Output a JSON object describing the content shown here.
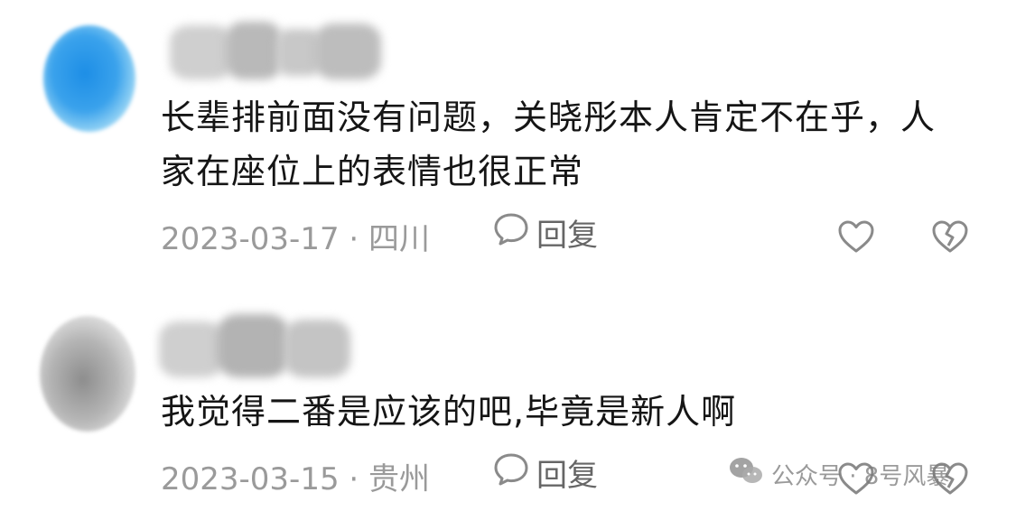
{
  "comments": [
    {
      "text": "长辈排前面没有问题，关晓彤本人肯定不在乎，人家在座位上的表情也很正常",
      "date": "2023-03-17",
      "location": "四川",
      "reply_label": "回复"
    },
    {
      "text": "我觉得二番是应该的吧,毕竟是新人啊",
      "date": "2023-03-15",
      "location": "贵州",
      "reply_label": "回复"
    }
  ],
  "meta_separator": "·",
  "icons": {
    "reply": "speech-bubble-icon",
    "like": "heart-icon",
    "dislike": "broken-heart-icon",
    "watermark": "wechat-icon"
  },
  "watermark": {
    "text": "公众号 · 8号风暴"
  },
  "colors": {
    "meta_text": "#9a9a9a",
    "body_text": "#151515",
    "icon": "#8a8a8a",
    "avatar_1": "#1d8ee6",
    "avatar_2": "#b5b5b5"
  }
}
